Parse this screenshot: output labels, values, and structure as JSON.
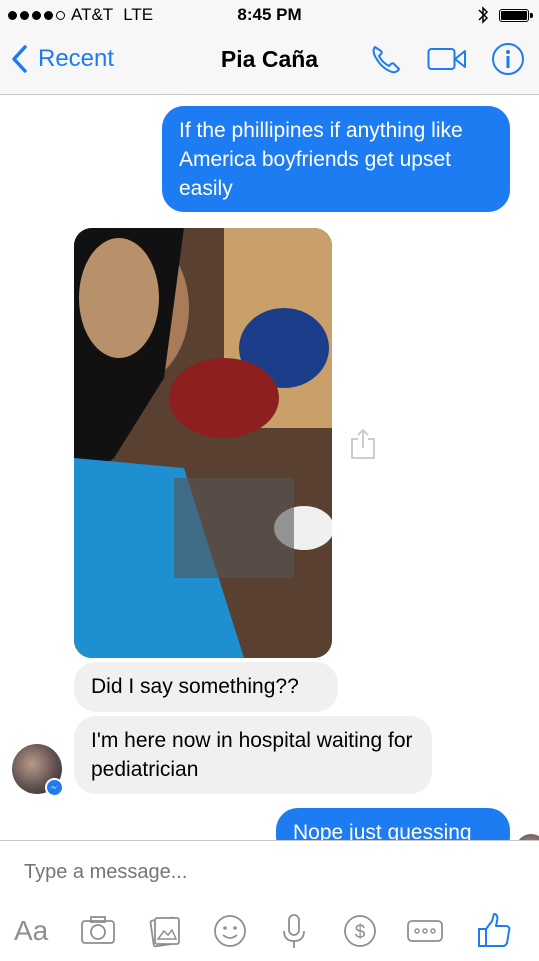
{
  "status": {
    "carrier": "AT&T",
    "network": "LTE",
    "time": "8:45 PM"
  },
  "nav": {
    "back_label": "Recent",
    "title": "Pia Caña",
    "icons": [
      "phone-icon",
      "video-icon",
      "info-icon"
    ]
  },
  "messages": [
    {
      "from": "me",
      "text": "If the phillipines if anything like America boyfriends get upset easily"
    },
    {
      "from": "them",
      "type": "photo"
    },
    {
      "from": "them",
      "text": "Did I say something??"
    },
    {
      "from": "them",
      "text": "I'm here now in hospital waiting for pediatrician"
    },
    {
      "from": "me",
      "text": "Nope just guessing"
    }
  ],
  "composer": {
    "placeholder": "Type a message...",
    "aa_label": "Aa",
    "tools": [
      "text-size",
      "camera-icon",
      "gallery-icon",
      "sticker-icon",
      "microphone-icon",
      "payment-icon",
      "more-icon",
      "like-icon"
    ]
  },
  "colors": {
    "accent": "#1d7cf2",
    "incoming_bubble": "#f1f0f0",
    "bar_bg": "#f7f7f7"
  }
}
